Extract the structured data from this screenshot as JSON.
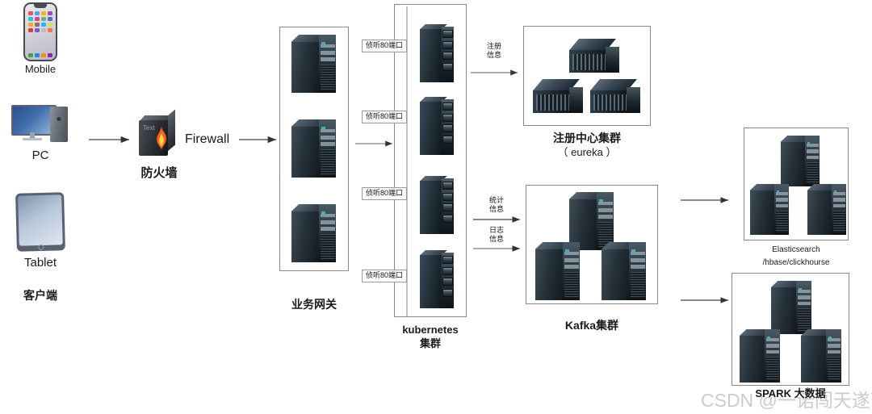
{
  "diagram": {
    "title": "microservice-architecture-diagram",
    "watermark": "CSDN @一诺闯天遂萝"
  },
  "clients": {
    "group_label": "客户端",
    "devices": [
      {
        "name": "Mobile",
        "icon": "mobile-phone-icon"
      },
      {
        "name": "PC",
        "icon": "desktop-computer-icon"
      },
      {
        "name": "Tablet",
        "icon": "tablet-icon"
      }
    ]
  },
  "firewall": {
    "icon": "firewall-flame-icon",
    "icon_text": "Text",
    "label_cn": "防火墙",
    "label_en": "Firewall"
  },
  "gateway": {
    "label": "业务网关",
    "server_count": 3,
    "icon": "tower-server-icon"
  },
  "kubernetes": {
    "label_line1": "kubernetes",
    "label_line2": "集群",
    "node_count": 4,
    "icon": "rack-server-icon",
    "port_labels": [
      "侦听80端口",
      "侦听80端口",
      "侦听80端口",
      "侦听80端口"
    ]
  },
  "registry": {
    "label_line1": "注册中心集群",
    "label_line2": "（ eureka ）",
    "server_count": 3,
    "icon": "blade-server-icon"
  },
  "kafka": {
    "label": "Kafka集群",
    "server_count": 3,
    "icon": "tower-server-icon"
  },
  "elasticsearch": {
    "label_line1": "Elasticsearch",
    "label_line2": "/hbase/clickhourse",
    "server_count": 3,
    "icon": "tower-server-icon"
  },
  "spark": {
    "label": "SPARK 大数据",
    "server_count": 3,
    "icon": "tower-server-icon"
  },
  "arrows": [
    {
      "id": "clients-to-firewall",
      "label": ""
    },
    {
      "id": "firewall-to-gateway",
      "label": ""
    },
    {
      "id": "gateway-to-k8s",
      "label": ""
    },
    {
      "id": "k8s-to-registry",
      "label_line1": "注册",
      "label_line2": "信息"
    },
    {
      "id": "k8s-to-kafka-stats",
      "label_line1": "统计",
      "label_line2": "信息"
    },
    {
      "id": "k8s-to-kafka-logs",
      "label_line1": "日志",
      "label_line2": "信息"
    },
    {
      "id": "kafka-to-elasticsearch",
      "label": ""
    },
    {
      "id": "kafka-to-spark",
      "label": ""
    }
  ],
  "colors": {
    "line": "#58585a",
    "box_border": "#888888",
    "text": "#1a1a1a",
    "watermark": "#c9ccd1",
    "server_dark": "#1d272e",
    "server_light": "#5d6c79"
  }
}
